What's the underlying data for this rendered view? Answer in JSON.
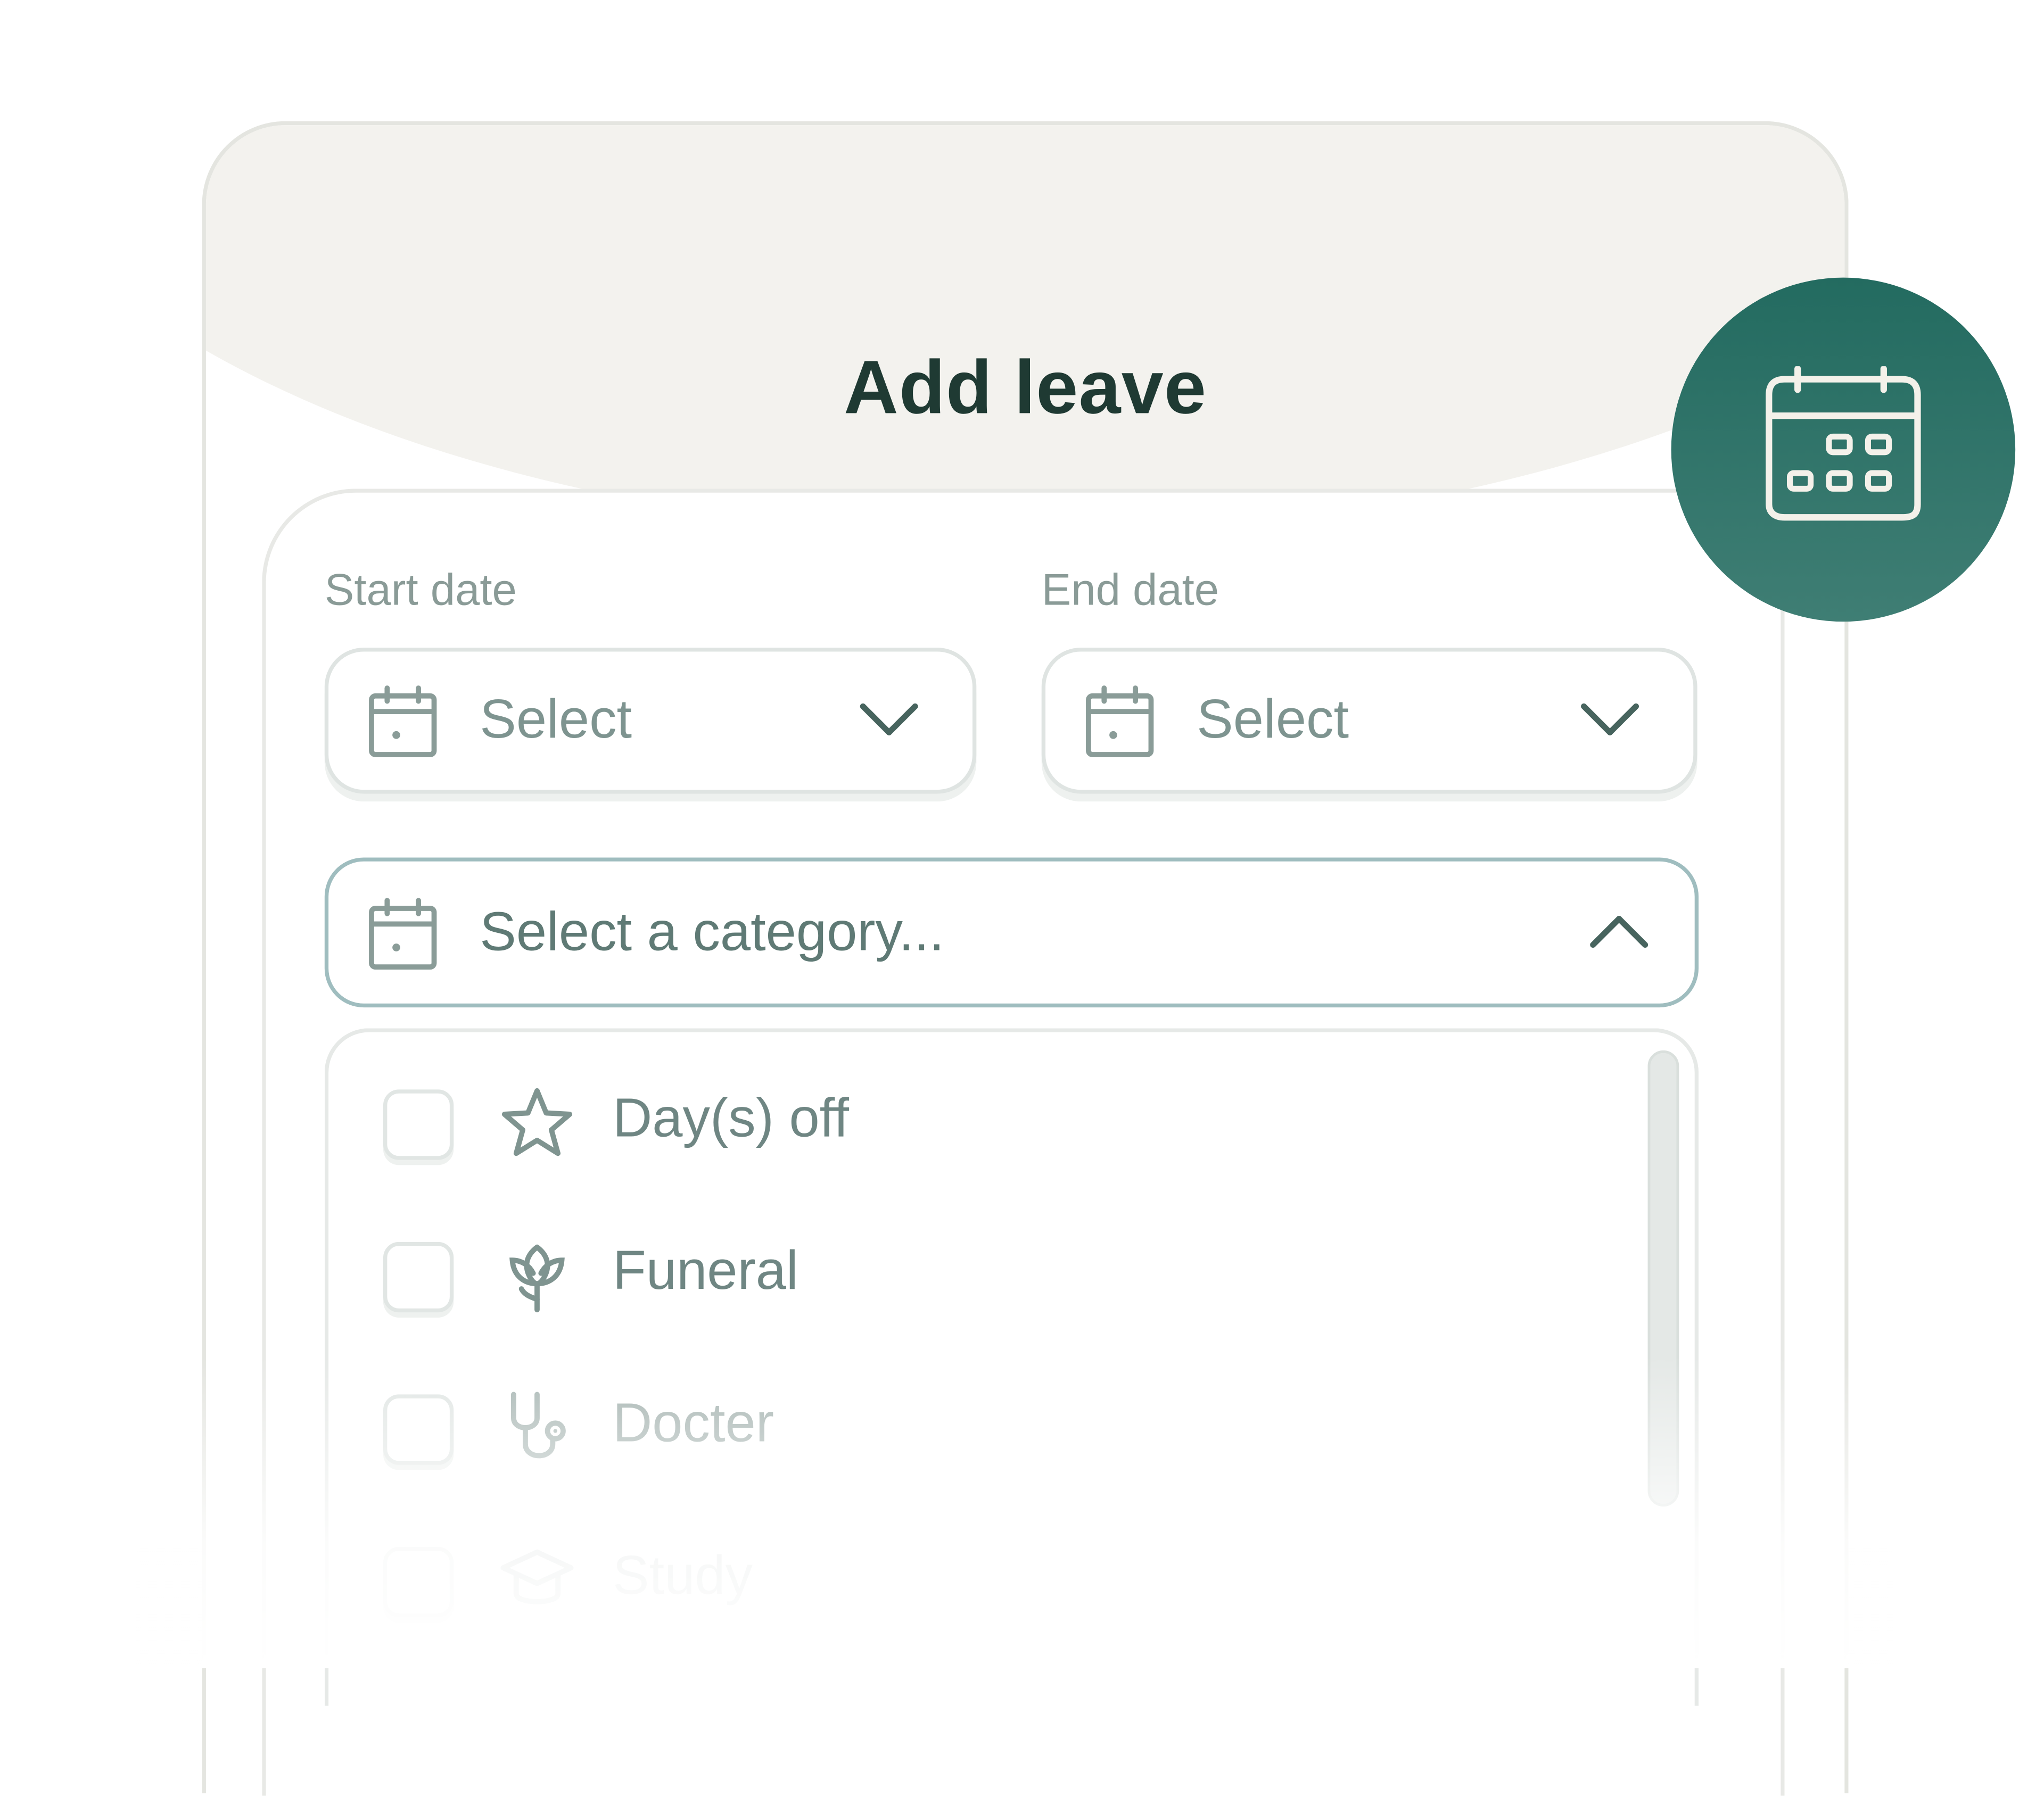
{
  "dialog": {
    "title": "Add leave"
  },
  "start_date": {
    "label": "Start date",
    "placeholder": "Select"
  },
  "end_date": {
    "label": "End date",
    "placeholder": "Select"
  },
  "category": {
    "placeholder": "Select a category...",
    "options": [
      {
        "label": "Day(s) off",
        "icon": "star-icon",
        "checked": false
      },
      {
        "label": "Funeral",
        "icon": "tulip-icon",
        "checked": false
      },
      {
        "label": "Docter",
        "icon": "stethoscope-icon",
        "checked": false
      },
      {
        "label": "Study",
        "icon": "graduation-cap-icon",
        "checked": false
      }
    ]
  },
  "badge": {
    "icon": "calendar-icon"
  },
  "colors": {
    "accent": "#2a6f64",
    "title": "#1f3a33",
    "muted": "#7e9490",
    "header_band": "#f3f2ee"
  }
}
